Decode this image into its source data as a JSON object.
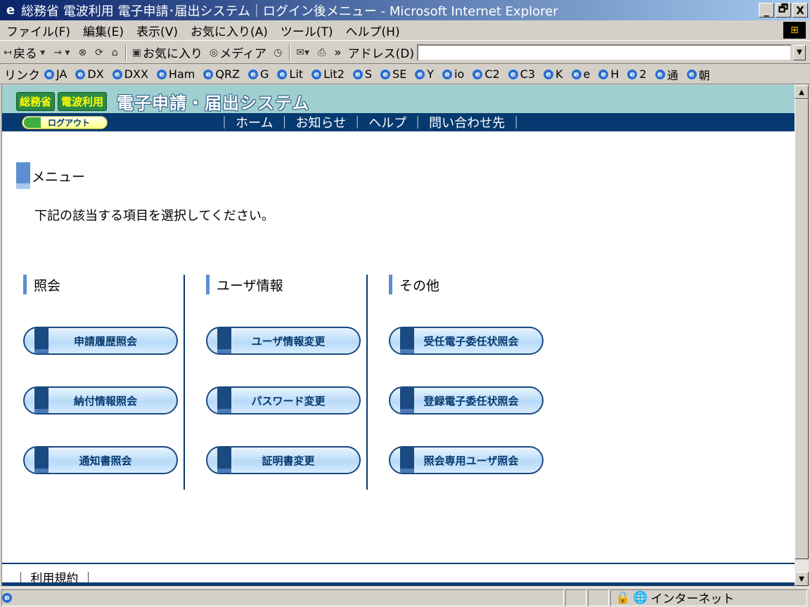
{
  "window": {
    "title": "総務省 電波利用 電子申請･届出システム｜ログイン後メニュー - Microsoft Internet Explorer",
    "buttons": [
      "_",
      "🗗",
      "X"
    ]
  },
  "menubar": {
    "items": [
      "ファイル(F)",
      "編集(E)",
      "表示(V)",
      "お気に入り(A)",
      "ツール(T)",
      "ヘルプ(H)"
    ]
  },
  "toolbar": {
    "back": "戻る",
    "favorites": "お気に入り",
    "media": "メディア",
    "more": "»",
    "address_label": "アドレス(D)",
    "address_value": ""
  },
  "links": {
    "label": "リンク",
    "items": [
      "JA",
      "DX",
      "DXX",
      "Ham",
      "QRZ",
      "G",
      "Lit",
      "Lit2",
      "S",
      "SE",
      "Y",
      "io",
      "C2",
      "C3",
      "K",
      "e",
      "H",
      "2",
      "通",
      "朝"
    ]
  },
  "site": {
    "badge1": "総務省",
    "badge2": "電波利用",
    "logo_text": "電子申請・届出システム",
    "logout": "ログアウト",
    "nav": [
      "ホーム",
      "お知らせ",
      "ヘルプ",
      "問い合わせ先"
    ],
    "nav_sep": "｜"
  },
  "page": {
    "section_title": "メニュー",
    "instruction": "下記の該当する項目を選択してください。",
    "columns": [
      {
        "heading": "照会",
        "buttons": [
          "申請履歴照会",
          "納付情報照会",
          "通知書照会"
        ]
      },
      {
        "heading": "ユーザ情報",
        "buttons": [
          "ユーザ情報変更",
          "パスワード変更",
          "証明書変更"
        ]
      },
      {
        "heading": "その他",
        "buttons": [
          "受任電子委任状照会",
          "登録電子委任状照会",
          "照会専用ユーザ照会"
        ]
      }
    ],
    "footer_link": "利用規約",
    "footer_sep": "｜"
  },
  "statusbar": {
    "zone": "インターネット"
  }
}
